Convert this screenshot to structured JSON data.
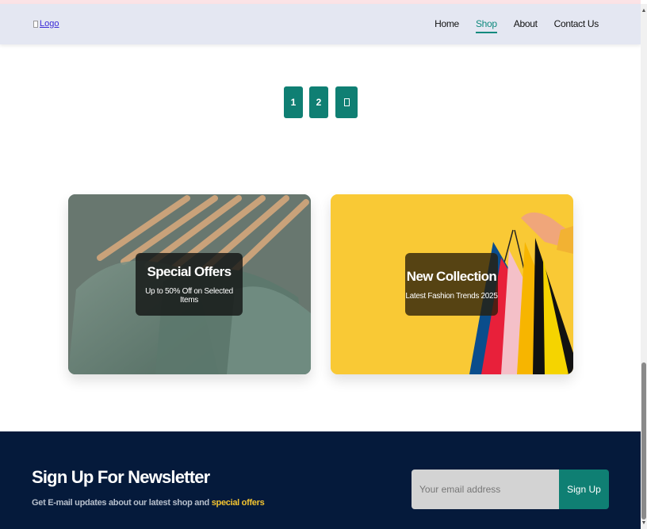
{
  "nav": {
    "logo_alt": "Logo",
    "links": [
      {
        "label": "Home",
        "active": false
      },
      {
        "label": "Shop",
        "active": true
      },
      {
        "label": "About",
        "active": false
      },
      {
        "label": "Contact Us",
        "active": false
      }
    ]
  },
  "pagination": {
    "pages": [
      "1",
      "2"
    ],
    "next_icon": "chevron-right-icon"
  },
  "promos": [
    {
      "title": "Special Offers",
      "subtitle": "Up to 50% Off on Selected Items"
    },
    {
      "title": "New Collection",
      "subtitle": "Latest Fashion Trends 2025"
    }
  ],
  "newsletter": {
    "title": "Sign Up For Newsletter",
    "subtitle_prefix": "Get E-mail updates about our latest shop and ",
    "subtitle_highlight": "special offers",
    "input_placeholder": "Your email address",
    "button_label": "Sign Up"
  },
  "colors": {
    "accent": "#0f7f73",
    "nav_bg": "#e4e7f2",
    "footer_bg": "#051a3b",
    "highlight": "#f4c430",
    "collection_bg": "#f9c935"
  }
}
